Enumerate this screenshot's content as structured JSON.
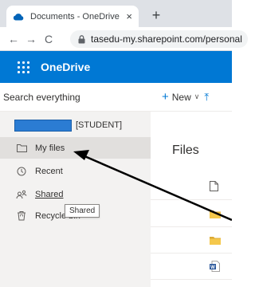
{
  "browser": {
    "tab_title": "Documents - OneDrive",
    "tab_close": "×",
    "new_tab": "+",
    "back": "←",
    "forward": "→",
    "reload": "C",
    "url": "tasedu-my.sharepoint.com/personal"
  },
  "header": {
    "app_name": "OneDrive",
    "brand_color": "#0078d4"
  },
  "leftnav": {
    "search_placeholder": "Search everything",
    "account_label": "[STUDENT]",
    "items": [
      {
        "label": "My files",
        "icon": "folder-icon",
        "selected": true
      },
      {
        "label": "Recent",
        "icon": "clock-icon",
        "selected": false
      },
      {
        "label": "Shared",
        "icon": "people-icon",
        "selected": false
      },
      {
        "label": "Recycle bin",
        "icon": "recycle-bin-icon",
        "selected": false
      }
    ],
    "tooltip": "Shared"
  },
  "main": {
    "new_button": "New",
    "title": "Files",
    "rows": [
      {
        "type": "header",
        "icon": "file-type-icon"
      },
      {
        "type": "folder",
        "icon": "folder-icon"
      },
      {
        "type": "folder",
        "icon": "folder-icon"
      },
      {
        "type": "document",
        "icon": "word-doc-icon"
      }
    ]
  }
}
